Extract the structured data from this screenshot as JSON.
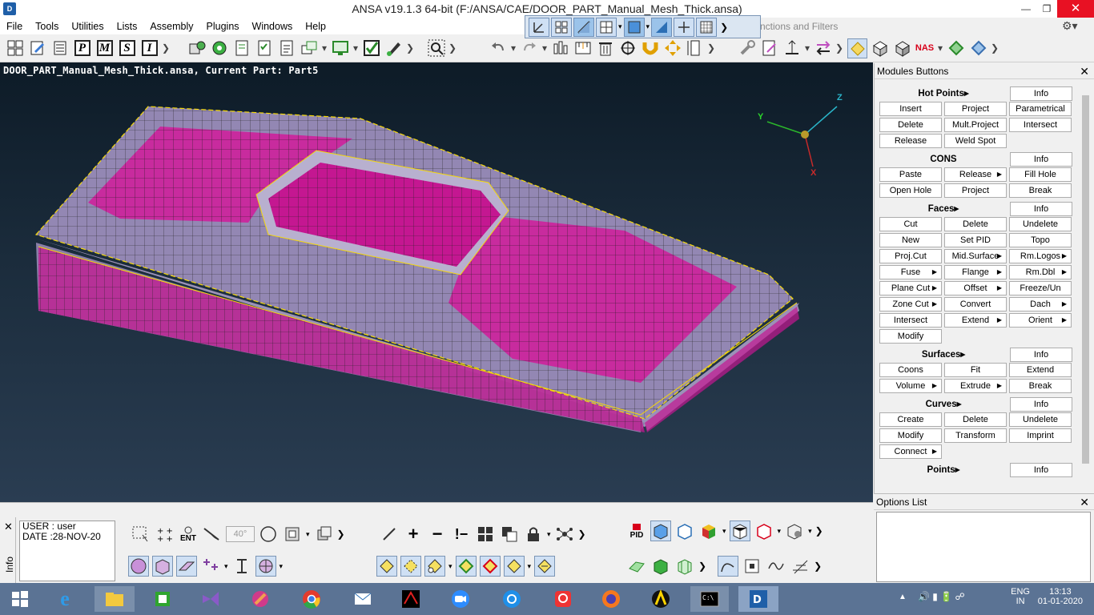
{
  "window": {
    "title": "ANSA v19.1.3 64-bit (F:/ANSA/CAE/DOOR_PART_Manual_Mesh_Thick.ansa)",
    "app_icon_text": "D"
  },
  "menu": [
    "File",
    "Tools",
    "Utilities",
    "Lists",
    "Assembly",
    "Plugins",
    "Windows",
    "Help"
  ],
  "search": {
    "placeholder": "nctions and Filters"
  },
  "toolbar_letters": [
    "P",
    "M",
    "S",
    "I"
  ],
  "badges": {
    "nas": "NAS",
    "ent": "ENT",
    "pid": "PID",
    "angle": "40°"
  },
  "viewport": {
    "caption": "DOOR_PART_Manual_Mesh_Thick.ansa,  Current Part: Part5",
    "axis_labels": {
      "y": "Y",
      "z": "Z",
      "x": "X"
    },
    "colors": {
      "surface": "#8a7fa8",
      "mesh_fill": "#d11b9a",
      "edge": "#f5d80a",
      "background_top": "#0d1b27"
    }
  },
  "modules": {
    "title": "Modules Buttons",
    "groups": [
      {
        "name": "Hot Points",
        "info": "Info",
        "rows": [
          [
            {
              "l": "Insert"
            },
            {
              "l": "Project"
            },
            {
              "l": "Parametrical"
            }
          ],
          [
            {
              "l": "Delete"
            },
            {
              "l": "Mult.Project"
            },
            {
              "l": "Intersect"
            }
          ],
          [
            {
              "l": "Release"
            },
            {
              "l": "Weld Spot"
            }
          ]
        ]
      },
      {
        "name": "CONS",
        "info": "Info",
        "rows": [
          [
            {
              "l": "Paste"
            },
            {
              "l": "Release",
              "a": true
            },
            {
              "l": "Fill Hole"
            }
          ],
          [
            {
              "l": "Open Hole"
            },
            {
              "l": "Project"
            },
            {
              "l": "Break"
            }
          ]
        ]
      },
      {
        "name": "Faces",
        "info": "Info",
        "rows": [
          [
            {
              "l": "Cut"
            },
            {
              "l": "Delete"
            },
            {
              "l": "Undelete"
            }
          ],
          [
            {
              "l": "New"
            },
            {
              "l": "Set PID"
            },
            {
              "l": "Topo"
            }
          ],
          [
            {
              "l": "Proj.Cut"
            },
            {
              "l": "Mid.Surface",
              "a": true
            },
            {
              "l": "Rm.Logos",
              "a": true
            }
          ],
          [
            {
              "l": "Fuse",
              "a": true
            },
            {
              "l": "Flange",
              "a": true
            },
            {
              "l": "Rm.Dbl",
              "a": true
            }
          ],
          [
            {
              "l": "Plane Cut",
              "a": true
            },
            {
              "l": "Offset",
              "a": true
            },
            {
              "l": "Freeze/Un"
            }
          ],
          [
            {
              "l": "Zone Cut",
              "a": true
            },
            {
              "l": "Convert"
            },
            {
              "l": "Dach",
              "a": true
            }
          ],
          [
            {
              "l": "Intersect"
            },
            {
              "l": "Extend",
              "a": true
            },
            {
              "l": "Orient",
              "a": true
            }
          ],
          [
            {
              "l": "Modify"
            }
          ]
        ]
      },
      {
        "name": "Surfaces",
        "info": "Info",
        "rows": [
          [
            {
              "l": "Coons"
            },
            {
              "l": "Fit"
            },
            {
              "l": "Extend"
            }
          ],
          [
            {
              "l": "Volume",
              "a": true
            },
            {
              "l": "Extrude",
              "a": true
            },
            {
              "l": "Break"
            }
          ]
        ]
      },
      {
        "name": "Curves",
        "info": "Info",
        "rows": [
          [
            {
              "l": "Create"
            },
            {
              "l": "Delete"
            },
            {
              "l": "Undelete"
            }
          ],
          [
            {
              "l": "Modify"
            },
            {
              "l": "Transform"
            },
            {
              "l": "Imprint"
            }
          ],
          [
            {
              "l": "Connect",
              "a": true
            }
          ]
        ]
      },
      {
        "name": "Points",
        "info": "Info",
        "rows": []
      }
    ]
  },
  "options": {
    "title": "Options List"
  },
  "info_panel": {
    "label": "Info",
    "lines": [
      "USER : user",
      "DATE :28-NOV-20"
    ]
  },
  "tray": {
    "lang1": "ENG",
    "lang2": "IN",
    "time": "13:13",
    "date": "01-01-2020"
  }
}
